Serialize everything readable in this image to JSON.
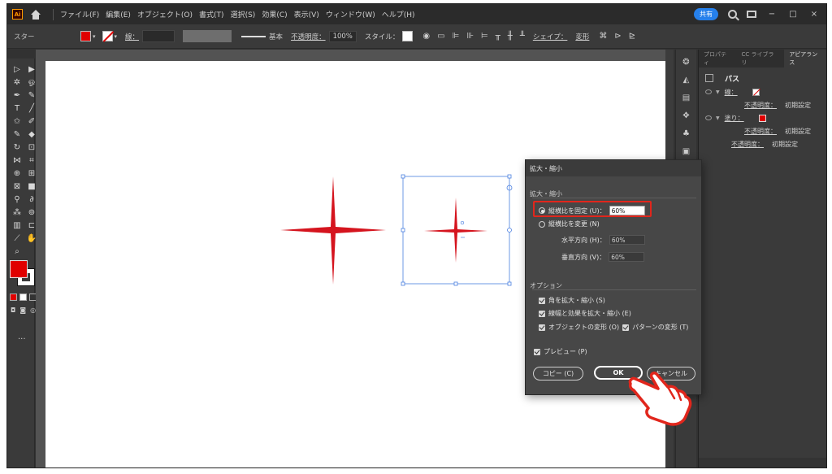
{
  "menubar": {
    "logo": "Ai",
    "items": [
      "ファイル(F)",
      "編集(E)",
      "オブジェクト(O)",
      "書式(T)",
      "選択(S)",
      "効果(C)",
      "表示(V)",
      "ウィンドウ(W)",
      "ヘルプ(H)"
    ],
    "share_label": "共有",
    "window_controls": [
      "−",
      "□",
      "×"
    ]
  },
  "controlbar": {
    "mode": "スター",
    "stroke_label": "線：",
    "line_label": "基本",
    "opacity_label": "不透明度：",
    "opacity_value": "100%",
    "style_label": "スタイル：",
    "shape_label": "シェイプ：",
    "transform_label": "変形"
  },
  "right_panel": {
    "tabs": [
      "プロパティ",
      "CC ライブラリ",
      "アピアランス"
    ],
    "active_tab": "アピアランス",
    "path_label": "パス",
    "stroke_label": "線：",
    "fill_label": "塗り：",
    "opacity_label": "不透明度：",
    "opacity_value": "初期設定"
  },
  "dialog": {
    "title": "拡大・縮小",
    "scale_group": "拡大・縮小",
    "uniform_label": "縦横比を固定 (U)：",
    "uniform_value": "60%",
    "nonuniform_label": "縦横比を変更 (N)",
    "horizontal_label": "水平方向 (H)：",
    "horizontal_value": "60%",
    "vertical_label": "垂直方向 (V)：",
    "vertical_value": "60%",
    "options_group": "オプション",
    "scale_corners": "角を拡大・縮小 (S)",
    "scale_strokes": "線幅と効果を拡大・縮小 (E)",
    "transform_objects": "オブジェクトの変形 (O)",
    "transform_patterns": "パターンの変形 (T)",
    "preview": "プレビュー (P)",
    "copy_button": "コピー (C)",
    "ok_button": "OK",
    "cancel_button": "キャンセル"
  },
  "colors": {
    "accent_red": "#e00000",
    "highlight": "#e1261c",
    "selection_blue": "#4a7fe0"
  }
}
